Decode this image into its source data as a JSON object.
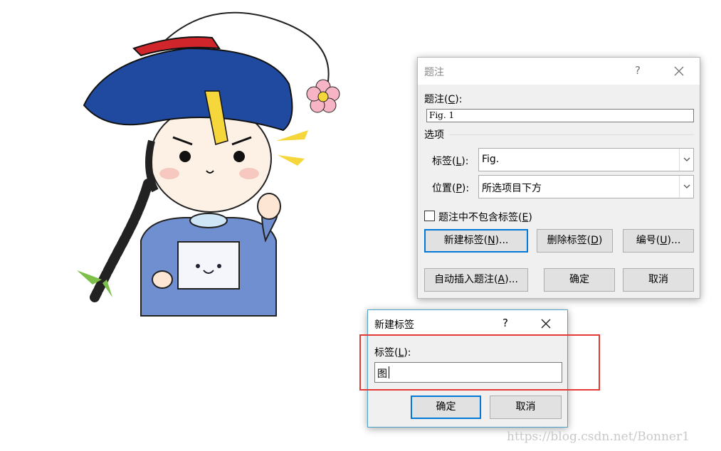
{
  "caption_dialog": {
    "title": "题注",
    "help": "?",
    "caption_label_pre": "题注(",
    "caption_label_key": "C",
    "caption_label_post": "):",
    "caption_value": "Fig. 1",
    "options_group": "选项",
    "label_label_pre": "标签(",
    "label_label_key": "L",
    "label_label_post": "):",
    "label_value": "Fig.",
    "position_label_pre": "位置(",
    "position_label_key": "P",
    "position_label_post": "):",
    "position_value": "所选项目下方",
    "exclude_label_pre": "题注中不包含标签(",
    "exclude_label_key": "E",
    "exclude_label_post": ")",
    "exclude_checked": false,
    "new_label_pre": "新建标签(",
    "new_label_key": "N",
    "new_label_post": ")...",
    "delete_label_pre": "删除标签(",
    "delete_label_key": "D",
    "delete_label_post": ")",
    "numbering_pre": "编号(",
    "numbering_key": "U",
    "numbering_post": ")...",
    "autocaption_pre": "自动插入题注(",
    "autocaption_key": "A",
    "autocaption_post": ")...",
    "ok": "确定",
    "cancel": "取消"
  },
  "new_label_dialog": {
    "title": "新建标签",
    "help": "?",
    "label_pre": "标签(",
    "label_key": "L",
    "label_post": "):",
    "input_value": "图",
    "ok": "确定",
    "cancel": "取消"
  },
  "watermark": "https://blog.csdn.net/Bonner1",
  "colors": {
    "highlight": "#e53935",
    "default_button_border": "#0078d7",
    "dialog_bg": "#f0f0f0"
  }
}
